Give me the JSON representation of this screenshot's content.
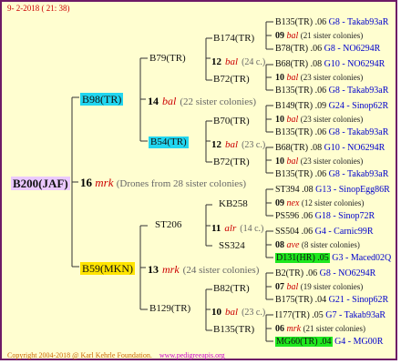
{
  "header": {
    "date": "9- 2-2018 ( 21: 38)"
  },
  "root": {
    "name": "B200(JAF)",
    "year": "16",
    "species": "mrk",
    "note": "(Drones from 28 sister colonies)"
  },
  "gen1": [
    {
      "name": "B98(TR)",
      "year": "14",
      "species": "bal",
      "note": "(22 sister colonies)"
    },
    {
      "name": "B59(MKN)",
      "year": "13",
      "species": "mrk",
      "note": "(24 sister colonies)"
    }
  ],
  "gen2": [
    {
      "name": "B79(TR)",
      "year": "12",
      "species": "bal",
      "note": "(24 c.)"
    },
    {
      "name": "B54(TR)",
      "year": "12",
      "species": "bal",
      "note": "(23 c.)"
    },
    {
      "name": "ST206",
      "year": "11",
      "species": "alr",
      "note": "(14 c.)"
    },
    {
      "name": "B129(TR)",
      "year": "10",
      "species": "bal",
      "note": "(23 c.)"
    }
  ],
  "gen3": [
    "B174(TR)",
    "B72(TR)",
    "B70(TR)",
    "B72(TR)",
    "KB258",
    "SS324",
    "B82(TR)",
    "B135(TR)"
  ],
  "gen4": [
    {
      "top": {
        "id": "B135(TR) .06",
        "loc": "G8 - Takab93aR"
      },
      "mid": {
        "year": "09",
        "sp": "bal",
        "note": "(21 sister colonies)"
      },
      "bot": {
        "id": "B78(TR) .06",
        "loc": "G8 - NO6294R"
      }
    },
    {
      "top": {
        "id": "B68(TR) .08",
        "loc": "G10 - NO6294R"
      },
      "mid": {
        "year": "10",
        "sp": "bal",
        "note": "(23 sister colonies)"
      },
      "bot": {
        "id": "B135(TR) .06",
        "loc": "G8 - Takab93aR"
      }
    },
    {
      "top": {
        "id": "B149(TR) .09",
        "loc": "G24 - Sinop62R"
      },
      "mid": {
        "year": "10",
        "sp": "bal",
        "note": "(23 sister colonies)"
      },
      "bot": {
        "id": "B135(TR) .06",
        "loc": "G8 - Takab93aR"
      }
    },
    {
      "top": {
        "id": "B68(TR) .08",
        "loc": "G10 - NO6294R"
      },
      "mid": {
        "year": "10",
        "sp": "bal",
        "note": "(23 sister colonies)"
      },
      "bot": {
        "id": "B135(TR) .06",
        "loc": "G8 - Takab93aR"
      }
    },
    {
      "top": {
        "id": "ST394 .08",
        "loc": "G13 - SinopEgg86R"
      },
      "mid": {
        "year": "09",
        "sp": "nex",
        "note": "(12 sister colonies)"
      },
      "bot": {
        "id": "PS596 .06",
        "loc": "G18 - Sinop72R"
      }
    },
    {
      "top": {
        "id": "SS504 .06",
        "loc": "G4 - Carnic99R"
      },
      "mid": {
        "year": "08",
        "sp": "ave",
        "note": "(8 sister colonies)"
      },
      "bot": {
        "id": "D131(HR) .05",
        "loc": "G3 - Maced02Q",
        "highlight": "green"
      }
    },
    {
      "top": {
        "id": "B2(TR) .06",
        "loc": "G8 - NO6294R"
      },
      "mid": {
        "year": "07",
        "sp": "bal",
        "note": "(19 sister colonies)"
      },
      "bot": {
        "id": "B175(TR) .04",
        "loc": "G21 - Sinop62R"
      }
    },
    {
      "top": {
        "id": "I177(TR) .05",
        "loc": "G7 - Takab93aR"
      },
      "mid": {
        "year": "06",
        "sp": "mrk",
        "note": "(21 sister colonies)"
      },
      "bot": {
        "id": "MG60(TR) .04",
        "loc": "G4 - MG00R",
        "highlight": "green"
      }
    }
  ],
  "footer": {
    "copyright": "Copyright 2004-2018 @ Karl Kehrle Foundation.",
    "site": "www.pedigreeapis.org"
  }
}
